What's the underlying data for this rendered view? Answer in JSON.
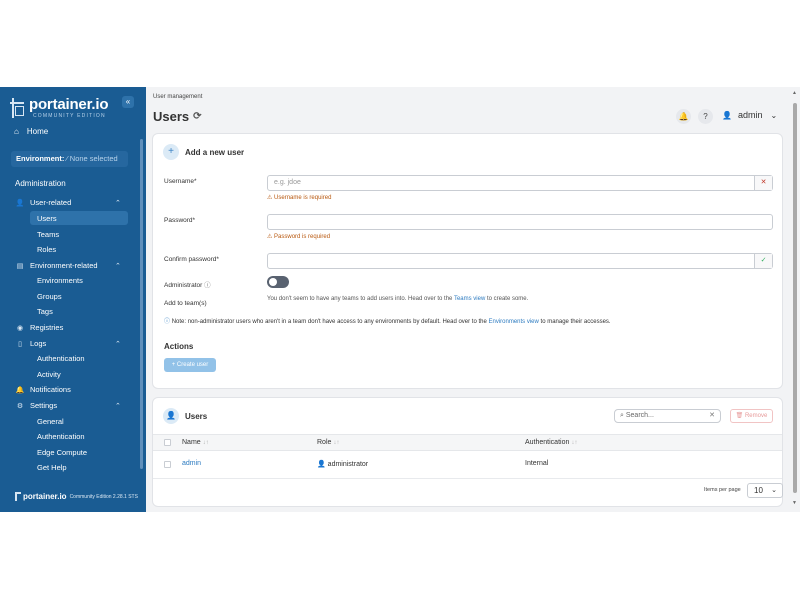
{
  "sidebar": {
    "logo_name": "portainer.io",
    "logo_sub": "COMMUNITY EDITION",
    "collapse": "«",
    "home": "Home",
    "environment_label": "Environment:",
    "environment_value": "None selected",
    "section": "Administration",
    "user_related": "User-related",
    "users": "Users",
    "teams": "Teams",
    "roles": "Roles",
    "environment_related": "Environment-related",
    "environments": "Environments",
    "groups": "Groups",
    "tags": "Tags",
    "registries": "Registries",
    "logs": "Logs",
    "authentication_logs": "Authentication",
    "activity": "Activity",
    "notifications": "Notifications",
    "settings": "Settings",
    "general": "General",
    "authentication": "Authentication",
    "edge_compute": "Edge Compute",
    "get_help": "Get Help",
    "footer_name": "portainer.io",
    "footer_edition": "Community Edition  2.28.1 STS"
  },
  "header": {
    "breadcrumb": "User management",
    "title": "Users",
    "user": "admin"
  },
  "form": {
    "title": "Add a new user",
    "username_label": "Username*",
    "username_placeholder": "e.g. jdoe",
    "username_error": "Username is required",
    "password_label": "Password*",
    "password_error": "Password is required",
    "confirm_label": "Confirm password*",
    "admin_label": "Administrator",
    "teams_label": "Add to team(s)",
    "teams_help_pre": "You don't seem to have any teams to add users into. Head over to the",
    "teams_help_link": "Teams view",
    "teams_help_post": "to create some.",
    "note_pre": "Note: non-administrator users who aren't in a team don't have access to any environments by default. Head over to the",
    "note_link": "Environments view",
    "note_post": "to manage their accesses.",
    "actions_title": "Actions",
    "create_button": "+ Create user"
  },
  "users_table": {
    "title": "Users",
    "search_placeholder": "Search...",
    "remove_button": "Remove",
    "columns": [
      "Name",
      "Role",
      "Authentication"
    ],
    "rows": [
      {
        "name": "admin",
        "role": "administrator",
        "auth": "Internal"
      }
    ],
    "items_per_page_label": "Items per page",
    "items_per_page_value": "10"
  },
  "icons": {
    "home": "home-icon",
    "refresh": "refresh-icon",
    "bell": "bell-icon",
    "help": "help-circle-icon",
    "user": "user-icon"
  },
  "colors": {
    "sidebar_bg": "#1a5c93",
    "accent": "#2d7bc0",
    "error": "#b8580f",
    "remove": "#e79a9a"
  }
}
